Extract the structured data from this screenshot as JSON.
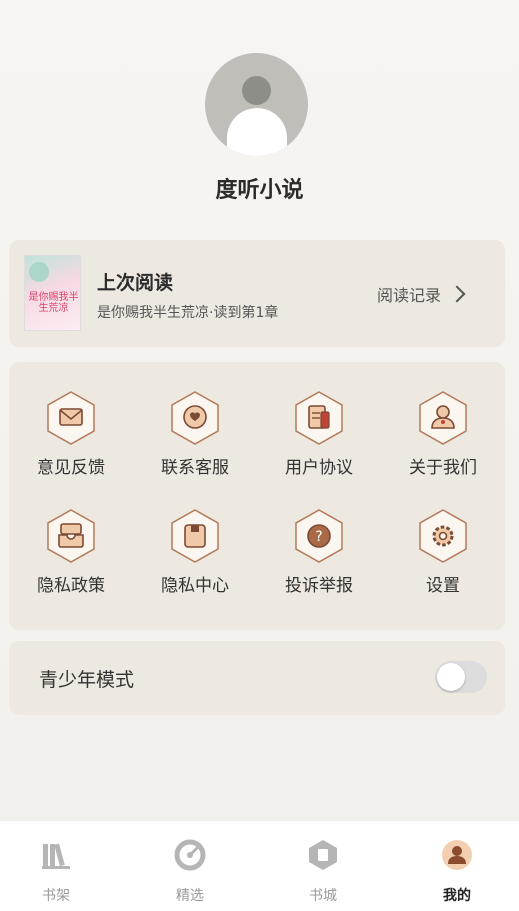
{
  "profile": {
    "app_name": "度听小说"
  },
  "last_read": {
    "title": "上次阅读",
    "subtitle": "是你赐我半生荒凉·读到第1章",
    "cover_text": "是你赐我半生荒凉",
    "history_label": "阅读记录"
  },
  "menu": [
    {
      "label": "意见反馈",
      "icon": "mail-icon"
    },
    {
      "label": "联系客服",
      "icon": "chat-heart-icon"
    },
    {
      "label": "用户协议",
      "icon": "document-icon"
    },
    {
      "label": "关于我们",
      "icon": "person-icon"
    },
    {
      "label": "隐私政策",
      "icon": "inbox-icon"
    },
    {
      "label": "隐私中心",
      "icon": "box-icon"
    },
    {
      "label": "投诉举报",
      "icon": "question-icon"
    },
    {
      "label": "设置",
      "icon": "gear-icon"
    }
  ],
  "teen_mode": {
    "label": "青少年模式",
    "enabled": false
  },
  "tabs": [
    {
      "label": "书架",
      "icon": "bookshelf-icon"
    },
    {
      "label": "精选",
      "icon": "target-icon"
    },
    {
      "label": "书城",
      "icon": "book-store-icon"
    },
    {
      "label": "我的",
      "icon": "profile-icon"
    }
  ],
  "colors": {
    "accent": "#9b5a3c",
    "hex_fill": "#fbf6f0",
    "card_bg": "#ede8e0"
  }
}
